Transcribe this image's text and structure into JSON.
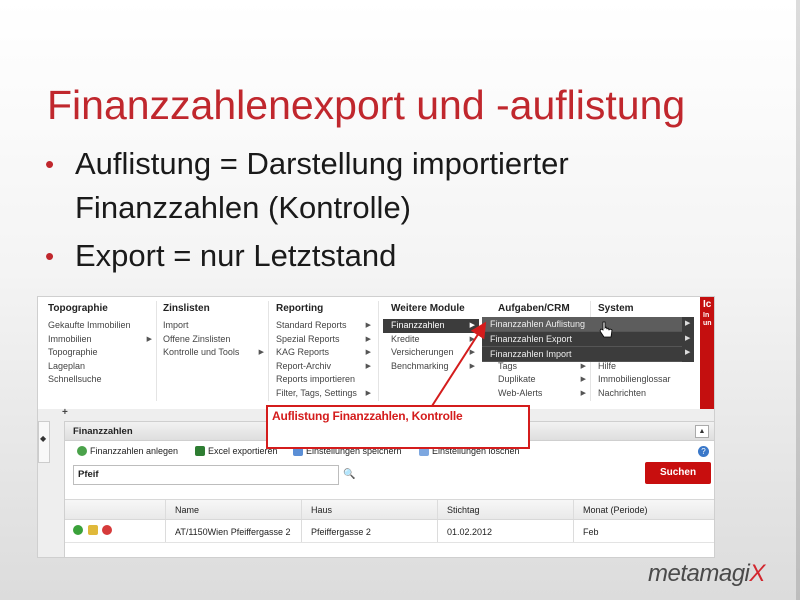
{
  "slide": {
    "title": "Finanzzahlenexport und -auflistung",
    "bullets": [
      "Auflistung = Darstellung importierter Finanzzahlen (Kontrolle)",
      "Export = nur Letztstand"
    ],
    "logo": {
      "text": "metamagi",
      "x": "X"
    }
  },
  "menu": {
    "columns": [
      {
        "head": "Topographie",
        "items": [
          "Gekaufte Immobilien",
          "Immobilien",
          "Topographie",
          "Lageplan",
          "Schnellsuche"
        ],
        "arrows": [
          false,
          true,
          false,
          false,
          false
        ]
      },
      {
        "head": "Zinslisten",
        "items": [
          "Import",
          "Offene Zinslisten",
          "Kontrolle und Tools"
        ],
        "arrows": [
          false,
          false,
          true
        ]
      },
      {
        "head": "Reporting",
        "items": [
          "Standard Reports",
          "Spezial Reports",
          "KAG Reports",
          "Report-Archiv",
          "Reports importieren",
          "Filter, Tags, Settings"
        ],
        "arrows": [
          true,
          true,
          true,
          true,
          false,
          true
        ]
      },
      {
        "head": "Weitere Module",
        "items": [
          "Finanzzahlen",
          "Kredite",
          "Versicherungen",
          "Benchmarking"
        ],
        "arrows": [
          true,
          true,
          true,
          true
        ]
      },
      {
        "head": "Aufgaben/CRM",
        "items": [
          "",
          "",
          "",
          "Tags",
          "Duplikate",
          "Web-Alerts"
        ],
        "arrows": [
          false,
          false,
          false,
          true,
          true,
          true
        ]
      },
      {
        "head": "System",
        "items": [
          "",
          "",
          "",
          "Hilfe",
          "Immobilienglossar",
          "Nachrichten"
        ],
        "arrows": [
          false,
          false,
          false,
          false,
          false,
          false
        ]
      }
    ],
    "brand_letters": "Ic",
    "brand_sub": "In\nun",
    "submenu": [
      "Finanzzahlen Auflistung",
      "Finanzzahlen Export",
      "Finanzzahlen Import"
    ]
  },
  "panel": {
    "title": "Finanzzahlen",
    "toggle": "▲",
    "toolbar": [
      "Finanzzahlen anlegen",
      "Excel exportieren",
      "Einstellungen speichern",
      "Einstellungen löschen"
    ],
    "help": "?",
    "search_value": "Pfeif",
    "search_button": "Suchen",
    "columns": [
      "Name",
      "Haus",
      "Stichtag",
      "Monat (Periode)"
    ],
    "row": [
      "AT/1150Wien Pfeiffergasse 2",
      "Pfeiffergasse 2",
      "01.02.2012",
      "Feb"
    ]
  },
  "annotation": {
    "text": "Auflistung Finanzzahlen, Kontrolle",
    "color": "#d41c1c"
  },
  "colors": {
    "title": "#c0272d",
    "accent": "#c80e0e",
    "menu_dark": "#3c3c3c"
  }
}
